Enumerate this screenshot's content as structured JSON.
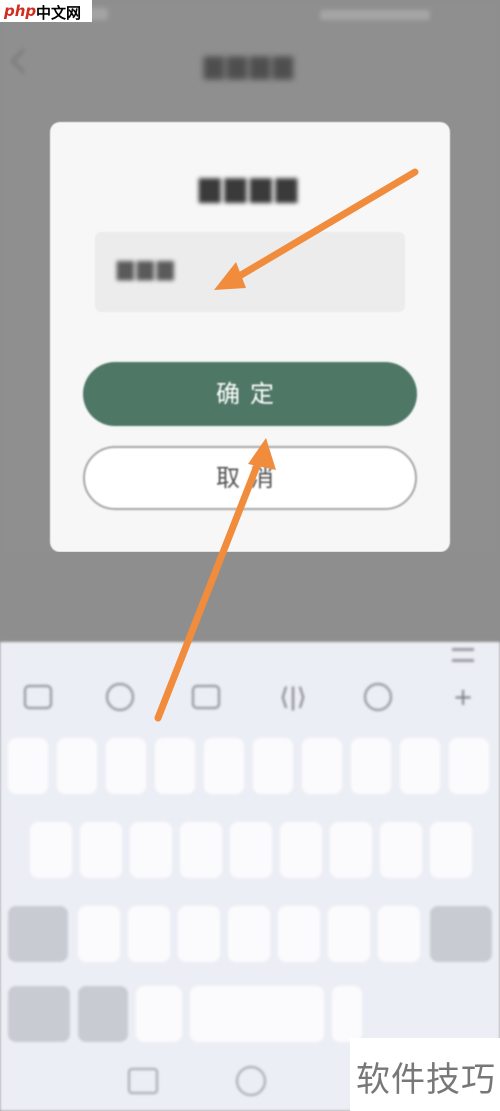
{
  "watermark_logo": {
    "brand": "php",
    "site": "中文网"
  },
  "watermark_corner": "软件技巧",
  "dialog": {
    "confirm_label": "确定",
    "cancel_label": "取消"
  },
  "colors": {
    "accent": "#4e7766",
    "arrow": "#f08c3c",
    "overlay": "#8e8e8e",
    "keyboard": "#eceef5"
  },
  "icons": [
    "back-icon",
    "keyboard-collapse-icon",
    "clipboard-icon",
    "emoji-icon",
    "settings-icon",
    "cursor-move-icon",
    "search-icon",
    "more-icon"
  ]
}
